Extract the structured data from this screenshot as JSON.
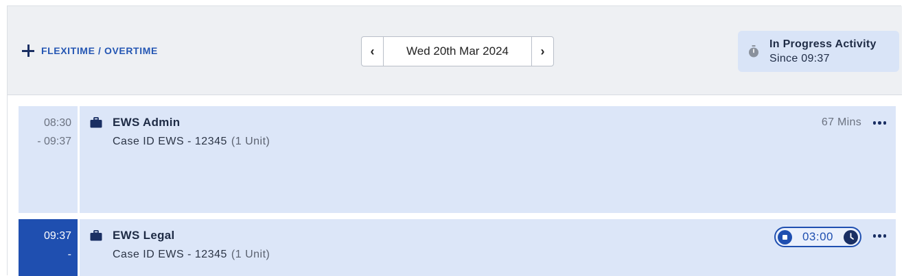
{
  "header": {
    "add_label": "FLEXITIME / OVERTIME",
    "date": "Wed 20th Mar 2024",
    "prev_glyph": "‹",
    "next_glyph": "›",
    "in_progress": {
      "title": "In Progress Activity",
      "since": "Since 09:37"
    }
  },
  "activities": [
    {
      "time_start": "08:30",
      "time_end": "- 09:37",
      "title": "EWS Admin",
      "case": "Case ID EWS - 12345",
      "unit": "(1 Unit)",
      "duration": "67 Mins"
    },
    {
      "time_start": "09:37",
      "time_end": "-",
      "title": "EWS Legal",
      "case": "Case ID EWS - 12345",
      "unit": "(1 Unit)",
      "timer": "03:00"
    }
  ],
  "colors": {
    "accent": "#1f4fb0",
    "row_bg": "#dce6f8",
    "header_bg": "#eef0f3"
  }
}
